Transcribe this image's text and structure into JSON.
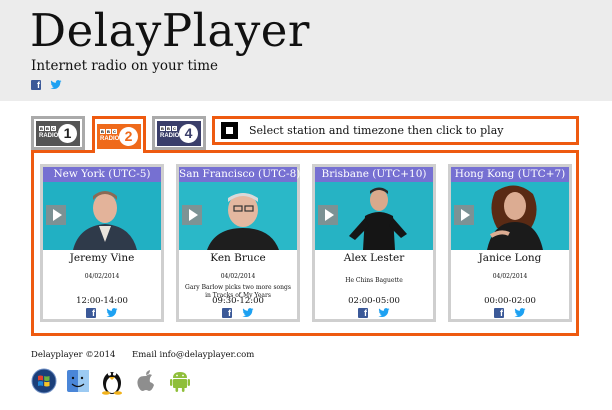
{
  "header": {
    "title": "DelayPlayer",
    "tagline": "Internet radio on your time",
    "social": [
      "facebook-icon",
      "twitter-icon"
    ]
  },
  "stations": [
    {
      "name": "BBC Radio 1",
      "bbc": [
        "B",
        "B",
        "C"
      ],
      "radio": "RADIO",
      "number": "1",
      "active": false,
      "color": "#555555"
    },
    {
      "name": "BBC Radio 2",
      "bbc": [
        "B",
        "B",
        "C"
      ],
      "radio": "RADIO",
      "number": "2",
      "active": true,
      "color": "#ef6a1b"
    },
    {
      "name": "BBC Radio 4",
      "bbc": [
        "B",
        "B",
        "C"
      ],
      "radio": "RADIO",
      "number": "4",
      "active": false,
      "color": "#3a3e6a"
    }
  ],
  "prompt": {
    "text": "Select station and timezone then click to play"
  },
  "cards": [
    {
      "city": "New York (UTC-5)",
      "presenter": "Jeremy Vine",
      "date": "04/02/2014",
      "description": "",
      "time": "12:00-14:00"
    },
    {
      "city": "San Francisco (UTC-8)",
      "presenter": "Ken Bruce",
      "date": "04/02/2014",
      "description": "Gary Barlow picks two more songs in Tracks of My Years",
      "time": "09:30-12:00"
    },
    {
      "city": "Brisbane (UTC+10)",
      "presenter": "Alex Lester",
      "date": "",
      "description": "He Chins Baguette",
      "time": "02:00-05:00"
    },
    {
      "city": "Hong Kong (UTC+7)",
      "presenter": "Janice Long",
      "date": "04/02/2014",
      "description": "",
      "time": "00:00-02:00"
    }
  ],
  "footer": {
    "copyright": "Delayplayer ©2014",
    "email": "Email info@delayplayer.com",
    "platforms": [
      "windows-icon",
      "mac-finder-icon",
      "linux-tux-icon",
      "apple-icon",
      "android-icon"
    ]
  },
  "colors": {
    "accent": "#ee5a10",
    "card_header": "#7670d2",
    "header_bg": "#ececec",
    "facebook": "#3b5998",
    "twitter": "#1da1f2"
  }
}
